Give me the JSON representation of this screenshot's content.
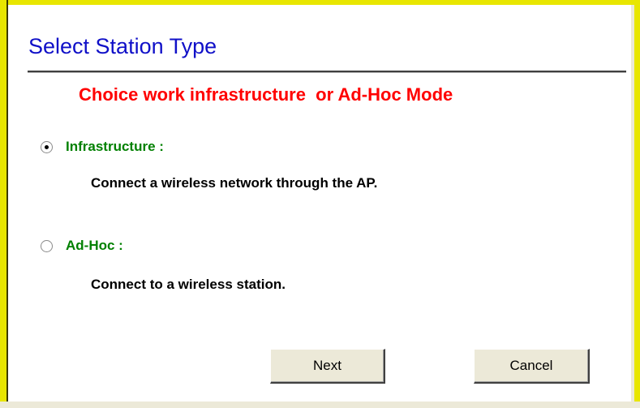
{
  "dialog": {
    "title": "Select Station Type",
    "subtitle": "Choice work infrastructure  or Ad-Hoc Mode"
  },
  "options": [
    {
      "label": "Infrastructure :",
      "description": "Connect a wireless network through the AP.",
      "selected": true
    },
    {
      "label": "Ad-Hoc :",
      "description": "Connect to a wireless station.",
      "selected": false
    }
  ],
  "buttons": {
    "next_label": "Next",
    "cancel_label": "Cancel"
  },
  "colors": {
    "title": "#1010c8",
    "subtitle": "#ff0000",
    "option_label": "#008000",
    "frame_border": "#e8e600",
    "button_face": "#ece9d8"
  }
}
